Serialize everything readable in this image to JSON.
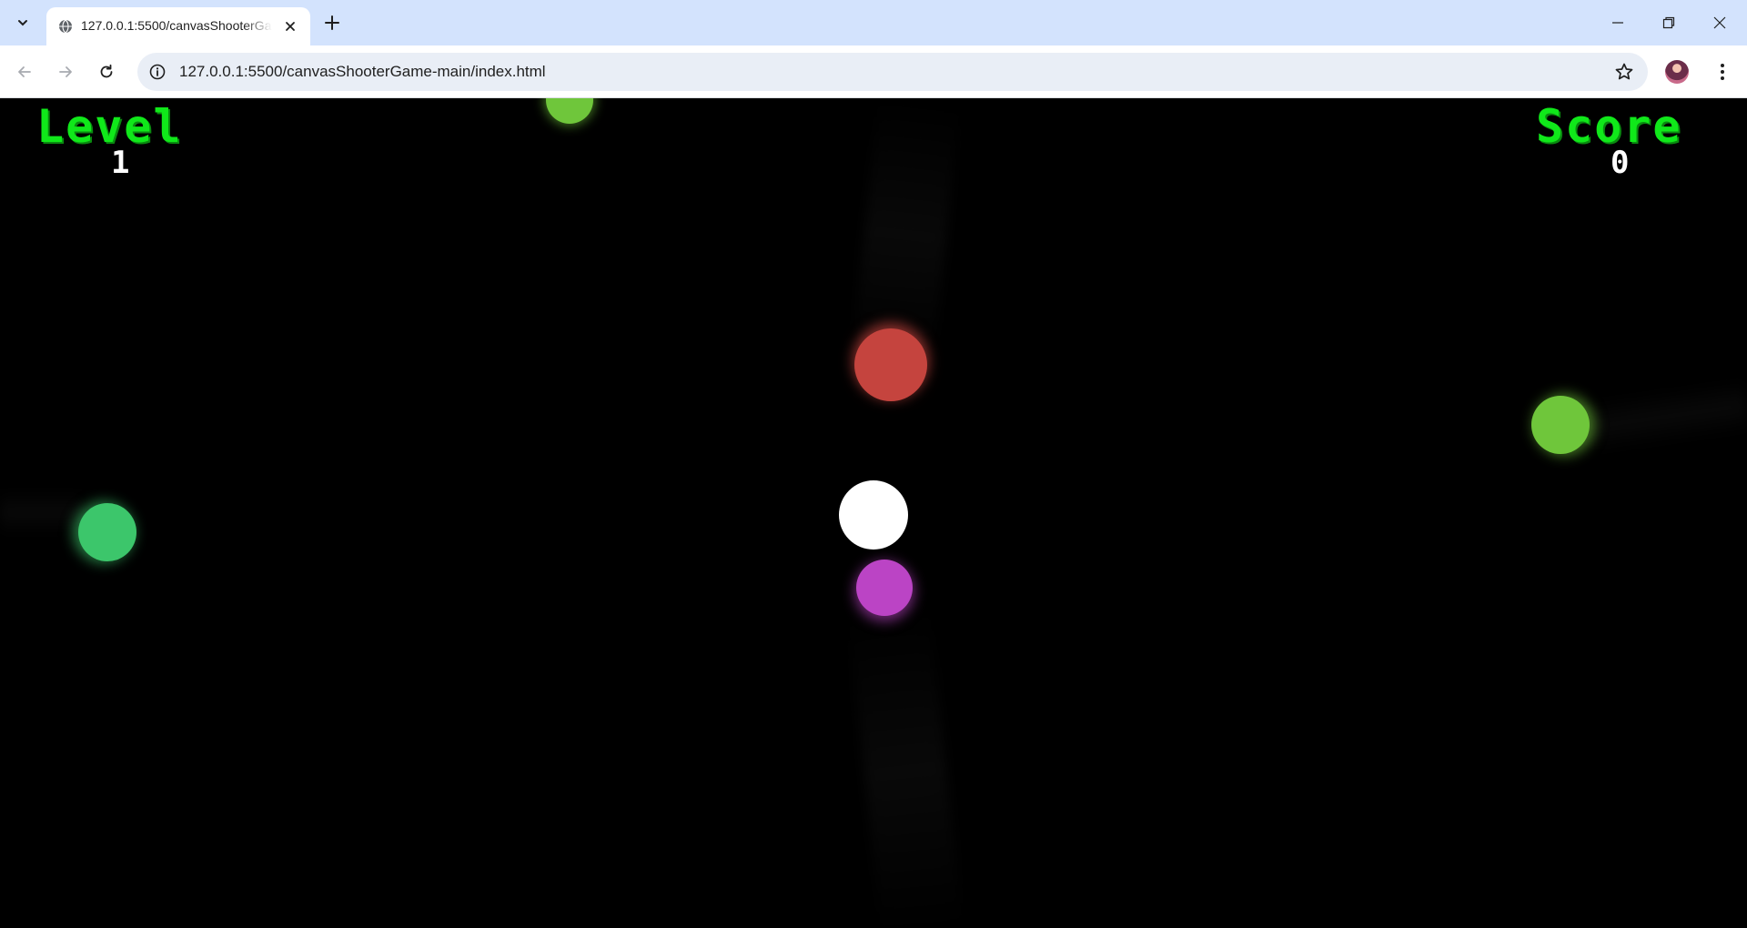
{
  "browser": {
    "tab_title": "127.0.0.1:5500/canvasShooterGame-main/index.html",
    "url": "127.0.0.1:5500/canvasShooterGame-main/index.html",
    "icons": {
      "tab_search": "chevron-down-icon",
      "favicon": "globe-icon",
      "close_tab": "close-icon",
      "new_tab": "plus-icon",
      "minimize": "minimize-icon",
      "restore": "restore-icon",
      "close_window": "close-icon",
      "back": "arrow-left-icon",
      "forward": "arrow-right-icon",
      "reload": "reload-icon",
      "site_info": "info-icon",
      "bookmark": "star-icon",
      "menu": "kebab-icon"
    },
    "colors": {
      "tabstrip": "#d3e3fd",
      "omnibox": "#e9eef6"
    }
  },
  "game": {
    "level_label": "Level",
    "level_value": "1",
    "score_label": "Score",
    "score_value": "0",
    "colors": {
      "hud_label": "#10e81a",
      "hud_value": "#ffffff",
      "background": "#000000",
      "player": "#ffffff",
      "enemies": [
        "#6fc63b",
        "#c5443e",
        "#6fc63b",
        "#3cc66b",
        "#bb44c5"
      ]
    }
  }
}
